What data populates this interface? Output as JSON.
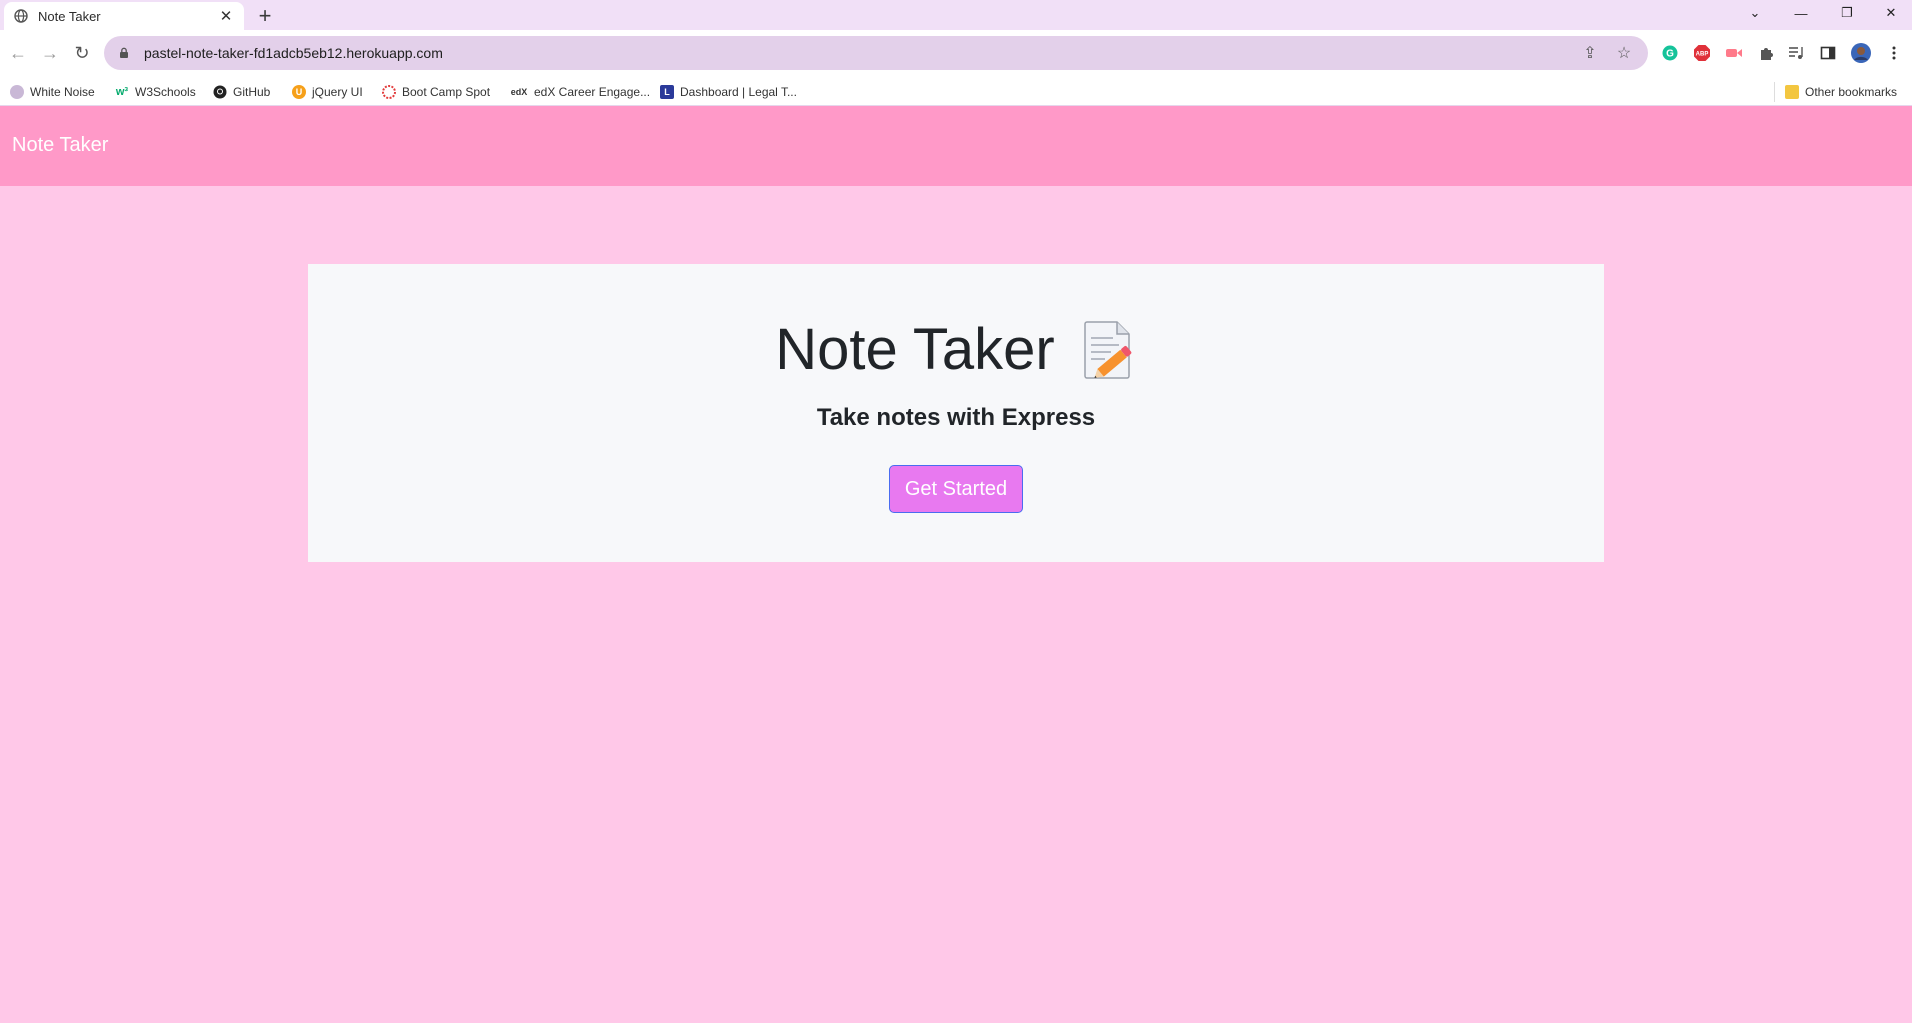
{
  "browser": {
    "tab_title": "Note Taker",
    "url": "pastel-note-taker-fd1adcb5eb12.herokuapp.com",
    "bookmarks": [
      {
        "label": "White Noise",
        "icon": "white-noise-icon"
      },
      {
        "label": "W3Schools",
        "icon": "w3schools-icon"
      },
      {
        "label": "GitHub",
        "icon": "github-icon"
      },
      {
        "label": "jQuery UI",
        "icon": "jquery-icon"
      },
      {
        "label": "Boot Camp Spot",
        "icon": "bootcamp-icon"
      },
      {
        "label": "edX Career Engage...",
        "icon": "edx-icon"
      },
      {
        "label": "Dashboard | Legal T...",
        "icon": "legal-icon"
      }
    ],
    "other_bookmarks": "Other bookmarks"
  },
  "navbar": {
    "brand": "Note Taker"
  },
  "jumbotron": {
    "title": "Note Taker",
    "lead": "Take notes with Express",
    "button_label": "Get Started"
  },
  "colors": {
    "navbar": "#ff99c8",
    "page_background": "#ffc8e8",
    "button": "#e879f0",
    "jumbotron": "#f7f8fa"
  }
}
